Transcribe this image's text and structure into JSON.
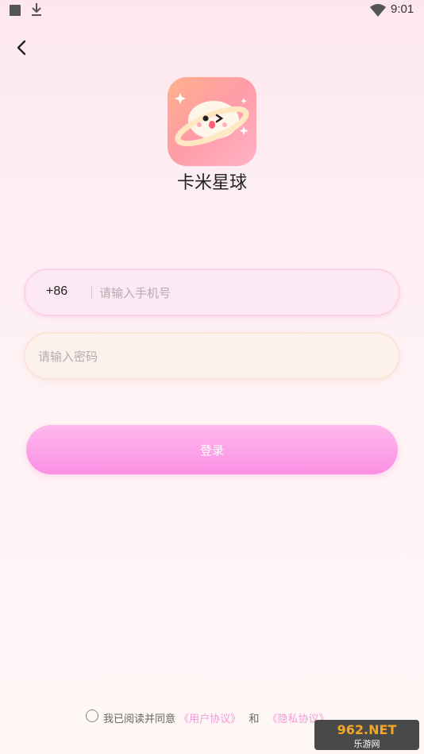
{
  "status_bar": {
    "time": "9:01",
    "icons": [
      "stop-square-icon",
      "download-icon",
      "wifi-icon"
    ]
  },
  "header": {
    "back_icon": "chevron-left-icon"
  },
  "app": {
    "name": "卡米星球",
    "icon": "planet-mascot-icon"
  },
  "phone": {
    "country_code": "+86",
    "placeholder": "请输入手机号"
  },
  "password": {
    "placeholder": "请输入密码"
  },
  "login_button": {
    "label": "登录"
  },
  "agreement": {
    "prefix": "我已阅读并同意",
    "user_agreement": "《用户协议》",
    "and": "和",
    "privacy_agreement": "《隐私协议》"
  },
  "watermark": {
    "brand_top": "962.NET",
    "brand_bottom": "乐游网"
  },
  "colors": {
    "accent_pink": "#fc8fe3",
    "link_pink": "#f39ad8",
    "background": "#fdeef3"
  }
}
